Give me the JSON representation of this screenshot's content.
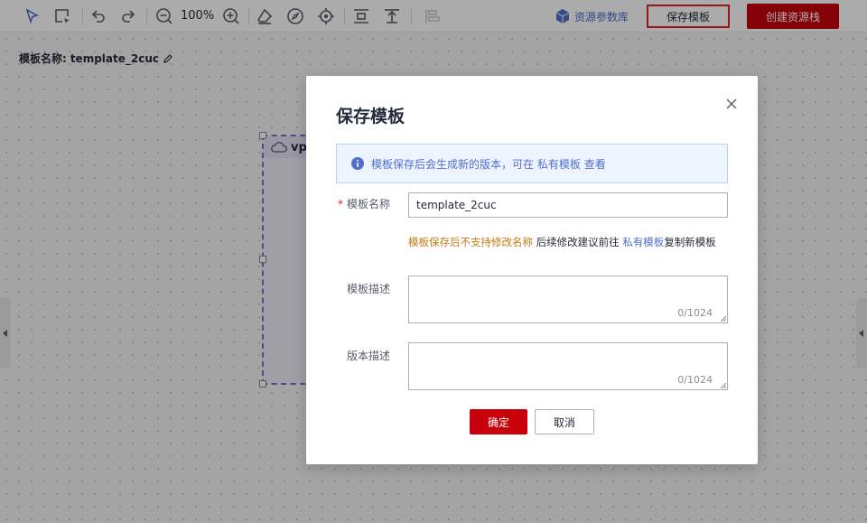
{
  "toolbar": {
    "zoom_level": "100%",
    "resource_lib_label": "资源参数库",
    "save_template_label": "保存模板",
    "create_stack_label": "创建资源栈"
  },
  "canvas": {
    "template_name_label": "模板名称:",
    "template_name_value": "template_2cuc",
    "vpc_label": "vp"
  },
  "dialog": {
    "title": "保存模板",
    "info": {
      "text": "模板保存后会生成新的版本，可在",
      "link": "私有模板",
      "suffix": "查看"
    },
    "name_field": {
      "required_mark": "*",
      "label": "模板名称",
      "value": "template_2cuc"
    },
    "hint": {
      "warn": "模板保存后不支持修改名称",
      "middle": "后续修改建议前往",
      "link": "私有模板",
      "suffix": "复制新模板"
    },
    "desc_field": {
      "label": "模板描述",
      "counter": "0/1024"
    },
    "version_field": {
      "label": "版本描述",
      "counter": "0/1024"
    },
    "ok_label": "确定",
    "cancel_label": "取消"
  },
  "colors": {
    "primary_red": "#c7000b",
    "link_blue": "#526ecc",
    "warn_orange": "#c57a10",
    "highlight_red": "#e02020"
  }
}
